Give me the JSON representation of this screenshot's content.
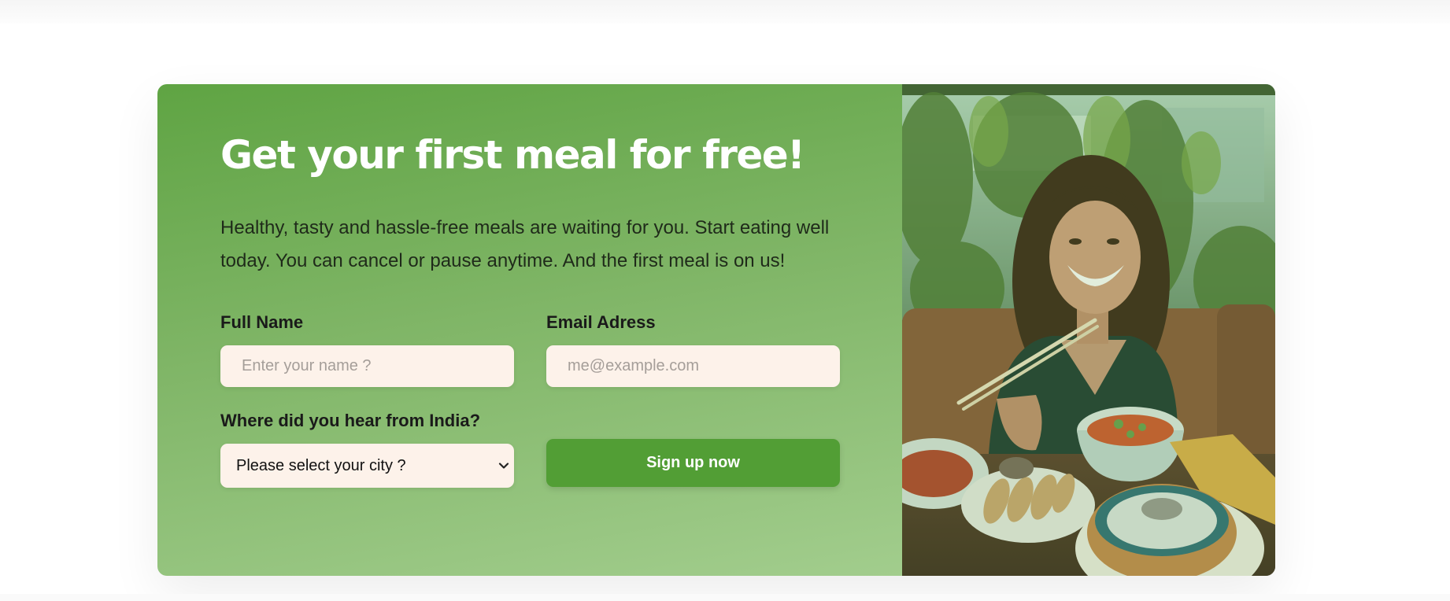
{
  "cta": {
    "heading": "Get your first meal for free!",
    "description": "Healthy, tasty and hassle-free meals are waiting for you. Start eating well today. You can cancel or pause anytime. And the first meal is on us!",
    "form": {
      "full_name_label": "Full Name",
      "full_name_placeholder": "Enter your name ?",
      "email_label": "Email Adress",
      "email_placeholder": "me@example.com",
      "source_label": "Where did you hear from India?",
      "city_select_value": "Please select your city ?",
      "submit_label": "Sign up now"
    },
    "image": {
      "icon": "woman-eating-meal-photo"
    },
    "colors": {
      "accent": "#529e35",
      "input_bg": "#fdf2ea",
      "heading": "#ffffff"
    }
  }
}
